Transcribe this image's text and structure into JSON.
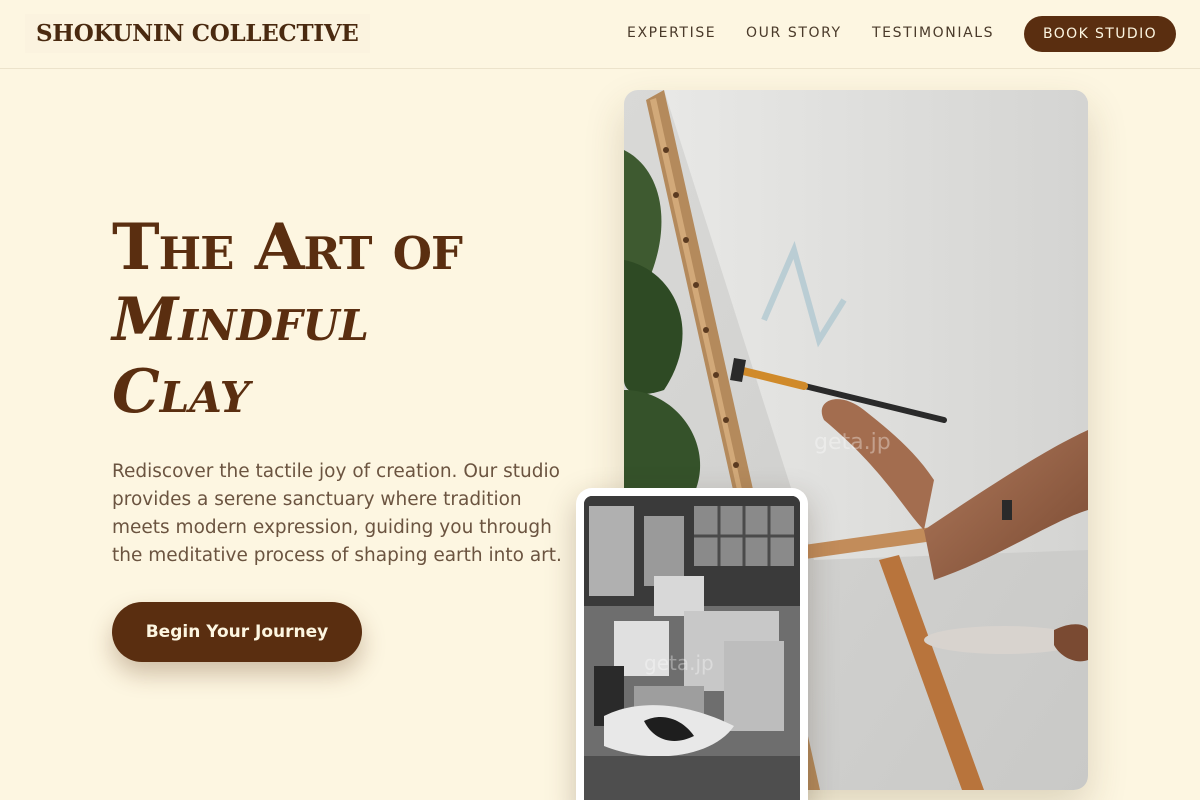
{
  "header": {
    "logo": "SHOKUNIN COLLECTIVE",
    "nav": [
      "EXPERTISE",
      "OUR STORY",
      "TESTIMONIALS"
    ],
    "book_label": "BOOK STUDIO"
  },
  "hero": {
    "headline_line1": "The Art of",
    "headline_line2": "Mindful",
    "headline_line3": "Clay",
    "subtitle": "Rediscover the tactile joy of creation. Our studio provides a serene sanctuary where tradition meets modern expression, guiding you through the meditative process of shaping earth into art.",
    "cta_label": "Begin Your Journey"
  },
  "images": {
    "main_watermark": "geta.jp",
    "small_watermark": "geta.jp"
  },
  "colors": {
    "background": "#fdf6e1",
    "brand": "#5a2e10"
  }
}
